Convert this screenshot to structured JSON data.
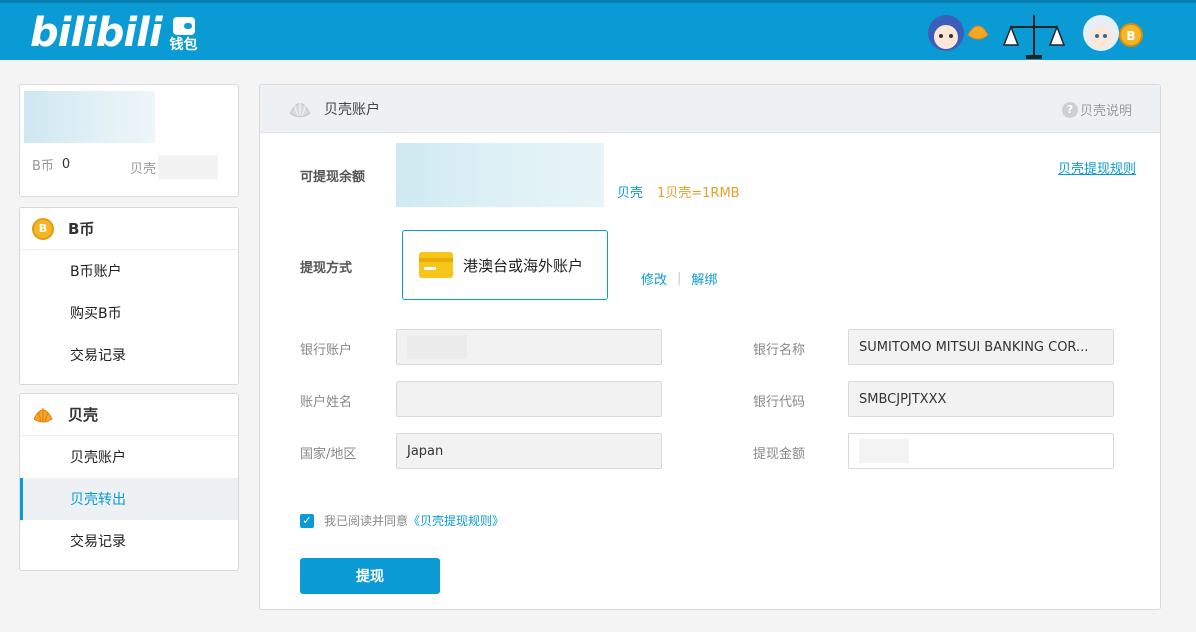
{
  "header": {
    "logo_text": "bilibili",
    "wallet_label": "钱包"
  },
  "profile": {
    "b_coin_label": "B币",
    "b_coin_value": "0",
    "shell_label": "贝壳"
  },
  "sidebar": {
    "b_group": {
      "title": "B币",
      "items": [
        {
          "label": "B币账户"
        },
        {
          "label": "购买B币"
        },
        {
          "label": "交易记录"
        }
      ]
    },
    "shell_group": {
      "title": "贝壳",
      "items": [
        {
          "label": "贝壳账户"
        },
        {
          "label": "贝壳转出"
        },
        {
          "label": "交易记录"
        }
      ]
    }
  },
  "main": {
    "title": "贝壳账户",
    "help_label": "贝壳说明",
    "balance_label": "可提现余额",
    "balance_unit": "贝壳",
    "rate": "1贝壳=1RMB",
    "rules_link": "贝壳提现规则",
    "method_label": "提现方式",
    "method_value": "港澳台或海外账户",
    "modify_label": "修改",
    "unbind_label": "解绑",
    "fields": {
      "bank_account_label": "银行账户",
      "account_name_label": "账户姓名",
      "country_label": "国家/地区",
      "country_value": "Japan",
      "bank_name_label": "银行名称",
      "bank_name_value": "SUMITOMO MITSUI BANKING COR...",
      "bank_code_label": "银行代码",
      "bank_code_value": "SMBCJPJTXXX",
      "amount_label": "提现金额"
    },
    "agree_text": "我已阅读并同意",
    "agree_rule": "《贝壳提现规则》",
    "submit_label": "提现"
  }
}
